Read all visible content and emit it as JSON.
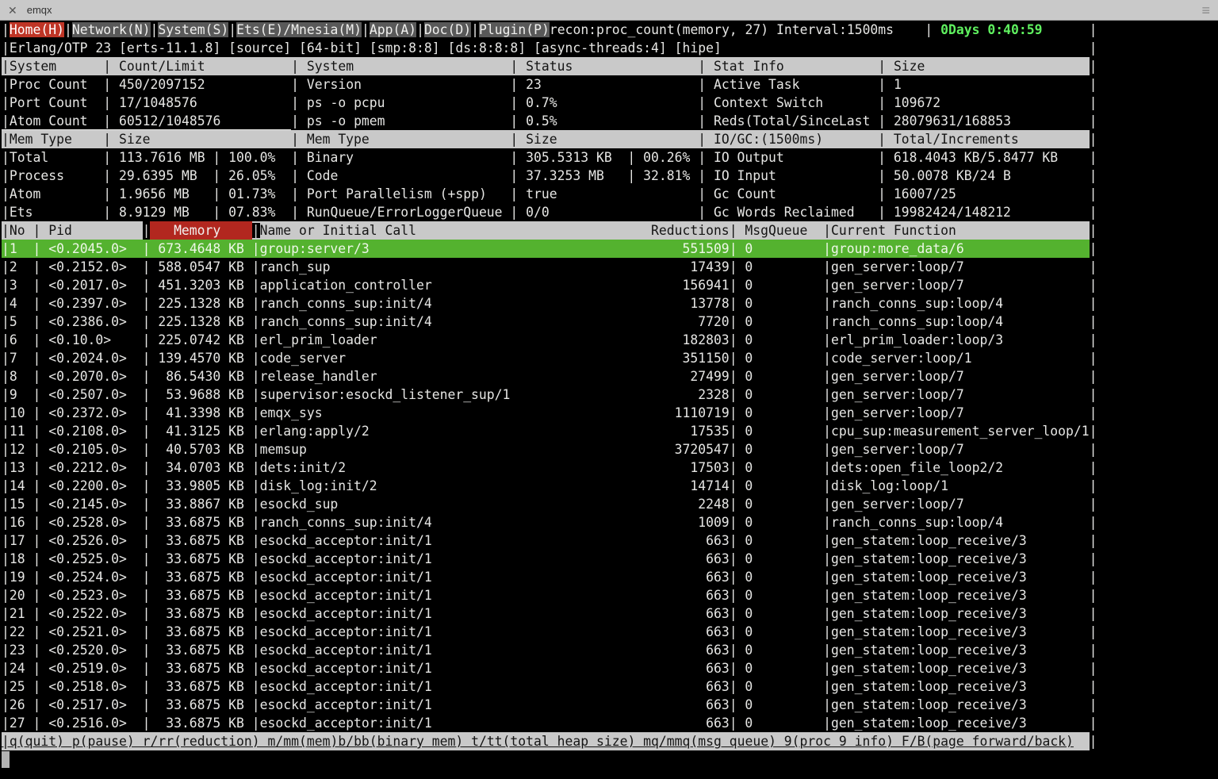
{
  "window": {
    "title": "emqx",
    "close_icon": "✕",
    "menu_icon": "≡"
  },
  "menu": {
    "items": [
      {
        "label": "Home(H)",
        "selected": true
      },
      {
        "label": "Network(N)"
      },
      {
        "label": "System(S)"
      },
      {
        "label": "Ets(E)/Mnesia(M)"
      },
      {
        "label": "App(A)"
      },
      {
        "label": "Doc(D)"
      },
      {
        "label": "Plugin(P)"
      }
    ],
    "command": "recon:proc_count(memory, 27) Interval:1500ms",
    "uptime": "0Days 0:40:59"
  },
  "otp_info": "Erlang/OTP 23 [erts-11.1.8] [source] [64-bit] [smp:8:8] [ds:8:8:8] [async-threads:4] [hipe]",
  "system_table": {
    "headers": [
      "System",
      "Count/Limit",
      "System",
      "Status",
      "Stat Info",
      "Size"
    ],
    "rows": [
      [
        "Proc Count",
        "450/2097152",
        "Version",
        "23",
        "Active Task",
        "1"
      ],
      [
        "Port Count",
        "17/1048576",
        "ps -o pcpu",
        "0.7%",
        "Context Switch",
        "109672"
      ],
      [
        "Atom Count",
        "60512/1048576",
        "ps -o pmem",
        "0.5%",
        "Reds(Total/SinceLast",
        "28079631/168853"
      ]
    ]
  },
  "memory_table": {
    "headers": [
      "Mem Type",
      "Size",
      "",
      "Mem Type",
      "Size",
      "",
      "IO/GC:(1500ms)",
      "Total/Increments"
    ],
    "rows": [
      [
        "Total",
        "113.7616 MB",
        "100.0%",
        "Binary",
        "305.5313 KB",
        "00.26%",
        "IO Output",
        "618.4043 KB/5.8477 KB"
      ],
      [
        "Process",
        "29.6395 MB",
        "26.05%",
        "Code",
        "37.3253 MB",
        "32.81%",
        "IO Input",
        "50.0078 KB/24 B"
      ],
      [
        "Atom",
        "1.9656 MB",
        "01.73%",
        "Port Parallelism (+spp)",
        "true",
        "",
        "Gc Count",
        "16007/25"
      ],
      [
        "Ets",
        "8.9129 MB",
        "07.83%",
        "RunQueue/ErrorLoggerQueue",
        "0/0",
        "",
        "Gc Words Reclaimed",
        "19982424/148212"
      ]
    ]
  },
  "process_table": {
    "headers": {
      "no": "No",
      "pid": "Pid",
      "memory": "Memory",
      "name": "Name or Initial Call",
      "reductions": "Reductions",
      "msgqueue": "MsgQueue",
      "current_function": "Current Function"
    },
    "rows": [
      {
        "no": "1",
        "pid": "<0.2045.0>",
        "memory": "673.4648 KB",
        "name": "group:server/3",
        "reductions": "551509",
        "msgqueue": "0",
        "current_function": "group:more_data/6",
        "selected": true
      },
      {
        "no": "2",
        "pid": "<0.2152.0>",
        "memory": "588.0547 KB",
        "name": "ranch_sup",
        "reductions": "17439",
        "msgqueue": "0",
        "current_function": "gen_server:loop/7"
      },
      {
        "no": "3",
        "pid": "<0.2017.0>",
        "memory": "451.3203 KB",
        "name": "application_controller",
        "reductions": "156941",
        "msgqueue": "0",
        "current_function": "gen_server:loop/7"
      },
      {
        "no": "4",
        "pid": "<0.2397.0>",
        "memory": "225.1328 KB",
        "name": "ranch_conns_sup:init/4",
        "reductions": "13778",
        "msgqueue": "0",
        "current_function": "ranch_conns_sup:loop/4"
      },
      {
        "no": "5",
        "pid": "<0.2386.0>",
        "memory": "225.1328 KB",
        "name": "ranch_conns_sup:init/4",
        "reductions": "7720",
        "msgqueue": "0",
        "current_function": "ranch_conns_sup:loop/4"
      },
      {
        "no": "6",
        "pid": "<0.10.0>",
        "memory": "225.0742 KB",
        "name": "erl_prim_loader",
        "reductions": "182803",
        "msgqueue": "0",
        "current_function": "erl_prim_loader:loop/3"
      },
      {
        "no": "7",
        "pid": "<0.2024.0>",
        "memory": "139.4570 KB",
        "name": "code_server",
        "reductions": "351150",
        "msgqueue": "0",
        "current_function": "code_server:loop/1"
      },
      {
        "no": "8",
        "pid": "<0.2070.0>",
        "memory": "86.5430 KB",
        "name": "release_handler",
        "reductions": "27499",
        "msgqueue": "0",
        "current_function": "gen_server:loop/7"
      },
      {
        "no": "9",
        "pid": "<0.2507.0>",
        "memory": "53.9688 KB",
        "name": "supervisor:esockd_listener_sup/1",
        "reductions": "2328",
        "msgqueue": "0",
        "current_function": "gen_server:loop/7"
      },
      {
        "no": "10",
        "pid": "<0.2372.0>",
        "memory": "41.3398 KB",
        "name": "emqx_sys",
        "reductions": "1110719",
        "msgqueue": "0",
        "current_function": "gen_server:loop/7"
      },
      {
        "no": "11",
        "pid": "<0.2108.0>",
        "memory": "41.3125 KB",
        "name": "erlang:apply/2",
        "reductions": "17535",
        "msgqueue": "0",
        "current_function": "cpu_sup:measurement_server_loop/1"
      },
      {
        "no": "12",
        "pid": "<0.2105.0>",
        "memory": "40.5703 KB",
        "name": "memsup",
        "reductions": "3720547",
        "msgqueue": "0",
        "current_function": "gen_server:loop/7"
      },
      {
        "no": "13",
        "pid": "<0.2212.0>",
        "memory": "34.0703 KB",
        "name": "dets:init/2",
        "reductions": "17503",
        "msgqueue": "0",
        "current_function": "dets:open_file_loop2/2"
      },
      {
        "no": "14",
        "pid": "<0.2200.0>",
        "memory": "33.9805 KB",
        "name": "disk_log:init/2",
        "reductions": "14714",
        "msgqueue": "0",
        "current_function": "disk_log:loop/1"
      },
      {
        "no": "15",
        "pid": "<0.2145.0>",
        "memory": "33.8867 KB",
        "name": "esockd_sup",
        "reductions": "2248",
        "msgqueue": "0",
        "current_function": "gen_server:loop/7"
      },
      {
        "no": "16",
        "pid": "<0.2528.0>",
        "memory": "33.6875 KB",
        "name": "ranch_conns_sup:init/4",
        "reductions": "1009",
        "msgqueue": "0",
        "current_function": "ranch_conns_sup:loop/4"
      },
      {
        "no": "17",
        "pid": "<0.2526.0>",
        "memory": "33.6875 KB",
        "name": "esockd_acceptor:init/1",
        "reductions": "663",
        "msgqueue": "0",
        "current_function": "gen_statem:loop_receive/3"
      },
      {
        "no": "18",
        "pid": "<0.2525.0>",
        "memory": "33.6875 KB",
        "name": "esockd_acceptor:init/1",
        "reductions": "663",
        "msgqueue": "0",
        "current_function": "gen_statem:loop_receive/3"
      },
      {
        "no": "19",
        "pid": "<0.2524.0>",
        "memory": "33.6875 KB",
        "name": "esockd_acceptor:init/1",
        "reductions": "663",
        "msgqueue": "0",
        "current_function": "gen_statem:loop_receive/3"
      },
      {
        "no": "20",
        "pid": "<0.2523.0>",
        "memory": "33.6875 KB",
        "name": "esockd_acceptor:init/1",
        "reductions": "663",
        "msgqueue": "0",
        "current_function": "gen_statem:loop_receive/3"
      },
      {
        "no": "21",
        "pid": "<0.2522.0>",
        "memory": "33.6875 KB",
        "name": "esockd_acceptor:init/1",
        "reductions": "663",
        "msgqueue": "0",
        "current_function": "gen_statem:loop_receive/3"
      },
      {
        "no": "22",
        "pid": "<0.2521.0>",
        "memory": "33.6875 KB",
        "name": "esockd_acceptor:init/1",
        "reductions": "663",
        "msgqueue": "0",
        "current_function": "gen_statem:loop_receive/3"
      },
      {
        "no": "23",
        "pid": "<0.2520.0>",
        "memory": "33.6875 KB",
        "name": "esockd_acceptor:init/1",
        "reductions": "663",
        "msgqueue": "0",
        "current_function": "gen_statem:loop_receive/3"
      },
      {
        "no": "24",
        "pid": "<0.2519.0>",
        "memory": "33.6875 KB",
        "name": "esockd_acceptor:init/1",
        "reductions": "663",
        "msgqueue": "0",
        "current_function": "gen_statem:loop_receive/3"
      },
      {
        "no": "25",
        "pid": "<0.2518.0>",
        "memory": "33.6875 KB",
        "name": "esockd_acceptor:init/1",
        "reductions": "663",
        "msgqueue": "0",
        "current_function": "gen_statem:loop_receive/3"
      },
      {
        "no": "26",
        "pid": "<0.2517.0>",
        "memory": "33.6875 KB",
        "name": "esockd_acceptor:init/1",
        "reductions": "663",
        "msgqueue": "0",
        "current_function": "gen_statem:loop_receive/3"
      },
      {
        "no": "27",
        "pid": "<0.2516.0>",
        "memory": "33.6875 KB",
        "name": "esockd_acceptor:init/1",
        "reductions": "663",
        "msgqueue": "0",
        "current_function": "gen_statem:loop_receive/3"
      }
    ]
  },
  "footer": {
    "help": "q(quit) p(pause) r/rr(reduction) m/mm(mem)b/bb(binary mem) t/tt(total heap size) mq/mmq(msg queue) 9(proc 9 info) F/B(page forward/back)"
  },
  "colors": {
    "accent_red": "#bf3526",
    "memory_header_red": "#b2271f",
    "selected_green": "#54b22f",
    "uptime_green": "#5ff05f",
    "header_gray": "#c9c9c9",
    "menu_gray": "#595959"
  }
}
